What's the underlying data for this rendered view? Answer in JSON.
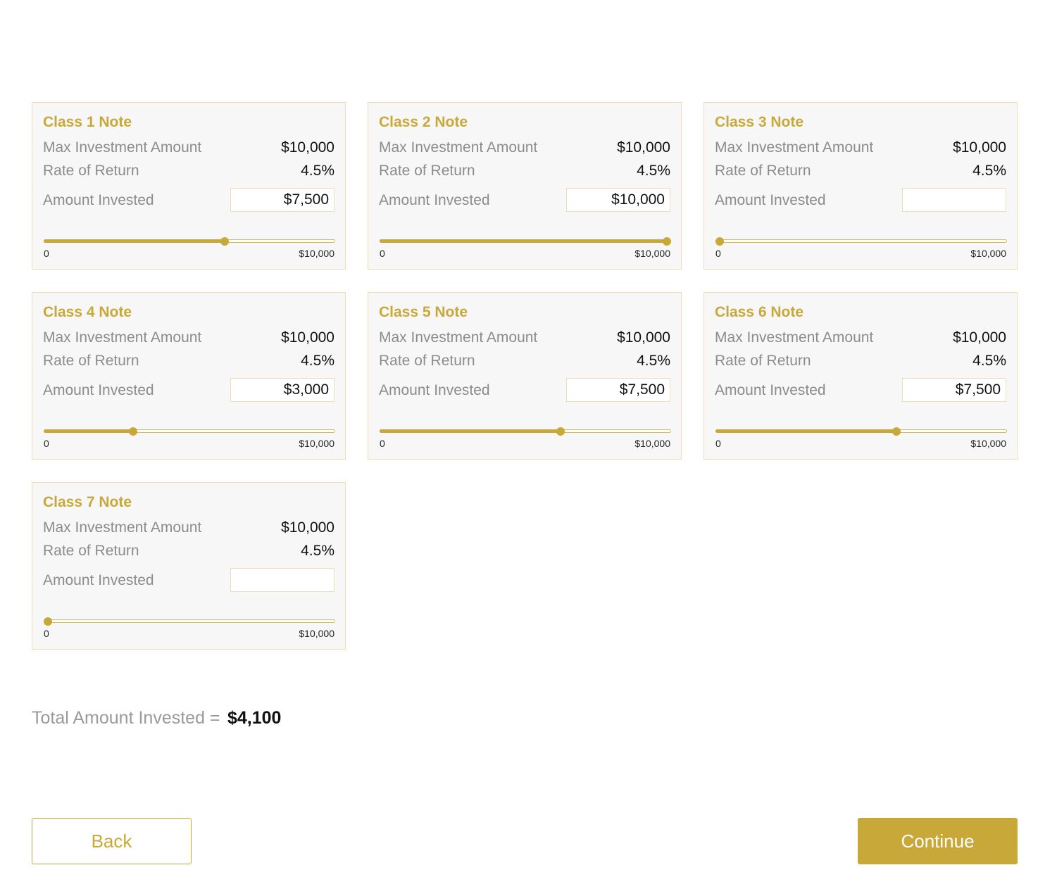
{
  "notes": [
    {
      "title": "Class 1 Note",
      "max_label": "Max Investment Amount",
      "max_value": "$10,000",
      "rate_label": "Rate of Return",
      "rate_value": "4.5%",
      "amount_label": "Amount Invested",
      "amount_value": "$7,500",
      "slider_min": "0",
      "slider_max": "$10,000",
      "slider_fraction": 0.625
    },
    {
      "title": "Class 2 Note",
      "max_label": "Max Investment Amount",
      "max_value": "$10,000",
      "rate_label": "Rate of Return",
      "rate_value": "4.5%",
      "amount_label": "Amount Invested",
      "amount_value": "$10,000",
      "slider_min": "0",
      "slider_max": "$10,000",
      "slider_fraction": 1.0
    },
    {
      "title": "Class 3 Note",
      "max_label": "Max Investment Amount",
      "max_value": "$10,000",
      "rate_label": "Rate of Return",
      "rate_value": "4.5%",
      "amount_label": "Amount Invested",
      "amount_value": "",
      "slider_min": "0",
      "slider_max": "$10,000",
      "slider_fraction": 0.0
    },
    {
      "title": "Class 4 Note",
      "max_label": "Max Investment Amount",
      "max_value": "$10,000",
      "rate_label": "Rate of Return",
      "rate_value": "4.5%",
      "amount_label": "Amount Invested",
      "amount_value": "$3,000",
      "slider_min": "0",
      "slider_max": "$10,000",
      "slider_fraction": 0.3
    },
    {
      "title": "Class 5 Note",
      "max_label": "Max Investment Amount",
      "max_value": "$10,000",
      "rate_label": "Rate of Return",
      "rate_value": "4.5%",
      "amount_label": "Amount Invested",
      "amount_value": "$7,500",
      "slider_min": "0",
      "slider_max": "$10,000",
      "slider_fraction": 0.625
    },
    {
      "title": "Class 6 Note",
      "max_label": "Max Investment Amount",
      "max_value": "$10,000",
      "rate_label": "Rate of Return",
      "rate_value": "4.5%",
      "amount_label": "Amount Invested",
      "amount_value": "$7,500",
      "slider_min": "0",
      "slider_max": "$10,000",
      "slider_fraction": 0.625
    },
    {
      "title": "Class 7 Note",
      "max_label": "Max Investment Amount",
      "max_value": "$10,000",
      "rate_label": "Rate of Return",
      "rate_value": "4.5%",
      "amount_label": "Amount Invested",
      "amount_value": "",
      "slider_min": "0",
      "slider_max": "$10,000",
      "slider_fraction": 0.0
    }
  ],
  "total": {
    "label": "Total Amount Invested =",
    "value": "$4,100"
  },
  "buttons": {
    "back": "Back",
    "continue": "Continue"
  },
  "colors": {
    "accent": "#c9a83a",
    "card_bg": "#f7f7f7",
    "card_border": "#eadfb6",
    "label_gray": "#8c8c8c"
  }
}
